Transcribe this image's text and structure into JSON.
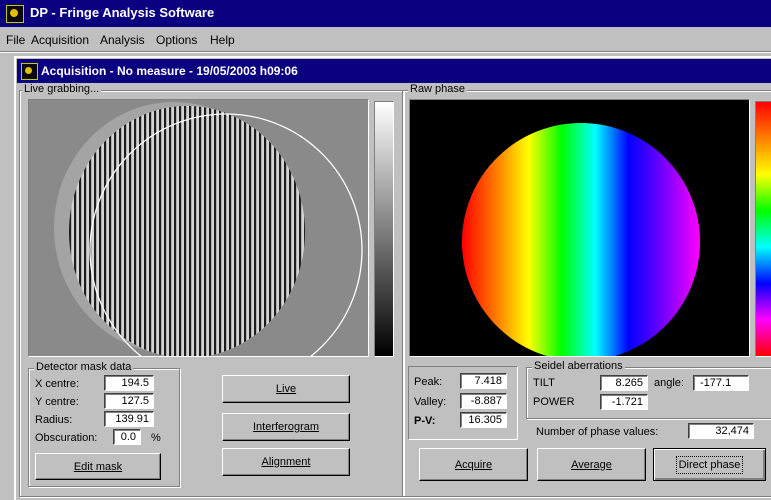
{
  "app": {
    "title": "DP - Fringe Analysis Software"
  },
  "menu": [
    "File",
    "Acquisition",
    "Analysis",
    "Options",
    "Help"
  ],
  "window": {
    "title": "Acquisition - No measure - 19/05/2003 h09:06"
  },
  "live": {
    "legend": "Live grabbing..."
  },
  "raw": {
    "legend": "Raw phase"
  },
  "mask": {
    "legend": "Detector mask data",
    "x_label": "X centre:",
    "x_value": "194.5",
    "y_label": "Y centre:",
    "y_value": "127.5",
    "r_label": "Radius:",
    "r_value": "139.91",
    "o_label": "Obscuration:",
    "o_value": "0.0",
    "o_unit": "%",
    "edit_button": "Edit mask"
  },
  "buttons": {
    "live": "Live",
    "interferogram": "Interferogram",
    "alignment": "Alignment",
    "acquire": "Acquire",
    "average": "Average",
    "direct_phase": "Direct phase"
  },
  "stats": {
    "peak_label": "Peak:",
    "peak_value": "7.418",
    "valley_label": "Valley:",
    "valley_value": "-8.887",
    "pv_label": "P-V:",
    "pv_value": "16.305"
  },
  "seidel": {
    "legend": "Seidel aberrations",
    "tilt_label": "TILT",
    "tilt_value": "8.265",
    "angle_label": "angle:",
    "angle_value": "-177.1",
    "power_label": "POWER",
    "power_value": "-1.721",
    "nphase_label": "Number of phase values:",
    "nphase_value": "32,474"
  }
}
